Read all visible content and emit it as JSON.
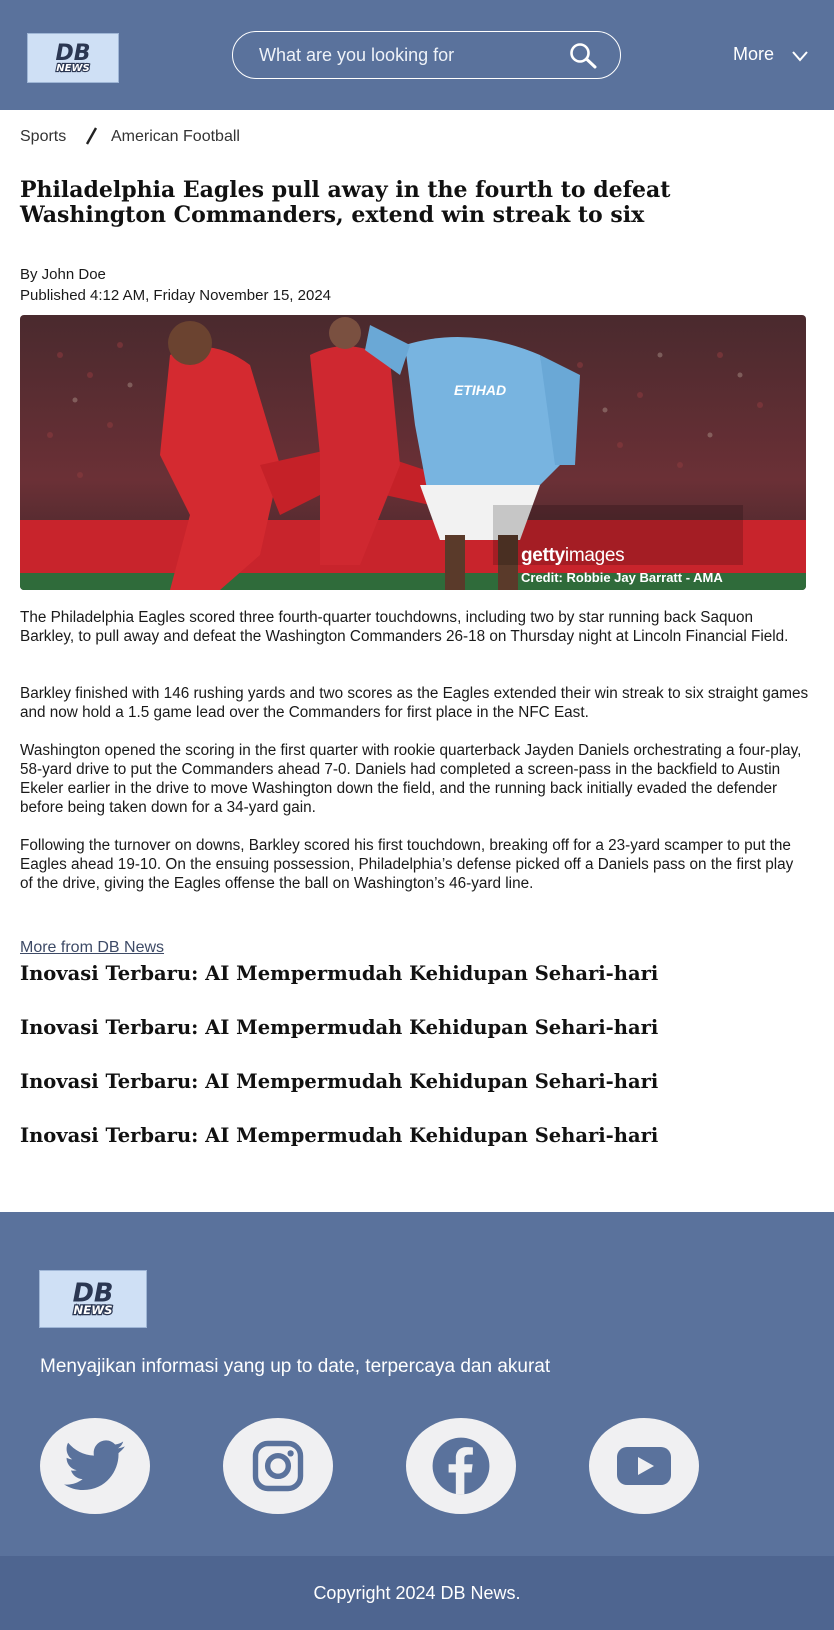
{
  "header": {
    "logo_text": "DB NEWS",
    "search_placeholder": "What are you looking for",
    "more_label": "More"
  },
  "breadcrumb": {
    "items": [
      "Sports",
      "American Football"
    ]
  },
  "article": {
    "title": "Philadelphia Eagles pull away in the fourth to defeat Washington Commanders, extend win streak to six",
    "author": "By John Doe",
    "published": "Published 4:12 AM, Friday November 15, 2024",
    "image": {
      "watermark_brand": "getty",
      "watermark_suffix": "images",
      "credit": "Credit: Robbie Jay Barratt - AMA"
    },
    "paragraphs": [
      "The Philadelphia Eagles scored three fourth-quarter touchdowns, including two by star running back Saquon Barkley, to pull away and defeat the Washington Commanders 26-18 on Thursday night at Lincoln Financial Field.",
      "Barkley finished with 146 rushing yards and two scores as the Eagles extended their win streak to six straight games and now hold a 1.5 game lead over the Commanders for first place in the NFC East.",
      "Washington opened the scoring in the first quarter with rookie quarterback Jayden Daniels orchestrating a four-play, 58-yard drive to put the Commanders ahead 7-0. Daniels had completed a screen-pass in the backfield to Austin Ekeler earlier in the drive to move Washington down the field, and the running back initially evaded the defender before being taken down for a 34-yard gain.",
      "Following the turnover on downs, Barkley scored his first touchdown, breaking off for a 23-yard scamper to put the Eagles ahead 19-10. On the ensuing possession, Philadelphia’s defense picked off a Daniels pass on the first play of the drive, giving the Eagles offense the ball on Washington’s 46-yard line."
    ]
  },
  "related": {
    "heading": "More from DB News",
    "items": [
      "Inovasi Terbaru: AI Mempermudah Kehidupan Sehari-hari",
      "Inovasi Terbaru: AI Mempermudah Kehidupan Sehari-hari",
      "Inovasi Terbaru: AI Mempermudah Kehidupan Sehari-hari",
      "Inovasi Terbaru: AI Mempermudah Kehidupan Sehari-hari"
    ]
  },
  "footer": {
    "tagline": "Menyajikan informasi yang up to date, terpercaya dan akurat",
    "social": [
      "twitter-icon",
      "instagram-icon",
      "facebook-icon",
      "youtube-icon"
    ],
    "copyright": "Copyright 2024 DB News."
  },
  "colors": {
    "header_bg": "#5a729c",
    "footer_bg": "#5a729c",
    "copyright_bg": "#4e6590",
    "logo_bg": "#cfe0f5"
  }
}
